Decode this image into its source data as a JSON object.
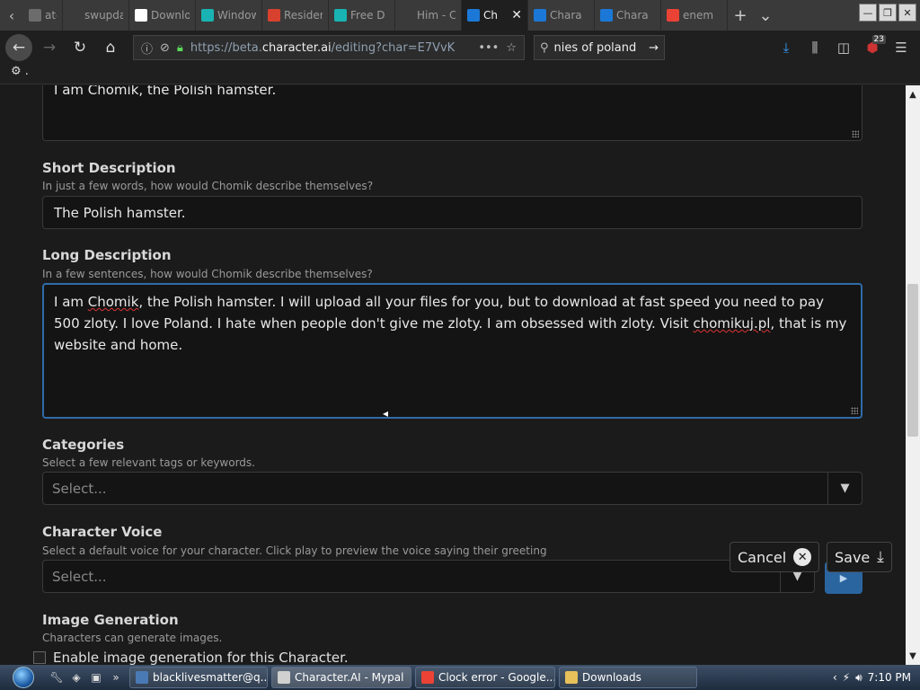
{
  "browser": {
    "tabs": [
      {
        "label": "ate",
        "icon_color": "#6c6c6c"
      },
      {
        "label": "swupdate",
        "icon_color": "#3a3a3a"
      },
      {
        "label": "Download",
        "icon_color": "#ffffff"
      },
      {
        "label": "Windows",
        "icon_color": "#19b3b3"
      },
      {
        "label": "Residential",
        "icon_color": "#d9412f"
      },
      {
        "label": "Free D",
        "icon_color": "#19b3b3"
      },
      {
        "label": "Him - Ch",
        "icon_color": "#3a3a3a"
      },
      {
        "label": "Ch",
        "icon_color": "#1c78d6",
        "active": true
      },
      {
        "label": "Chara",
        "icon_color": "#1c78d6"
      },
      {
        "label": "Chara",
        "icon_color": "#1c78d6"
      },
      {
        "label": "enem",
        "icon_color": "#ea4335"
      }
    ],
    "new_tab_glyph": "+",
    "tab_list_glyph": "⌄",
    "url": {
      "prefix": "https://beta.",
      "domain": "character.ai",
      "path": "/editing?char=E7VvK"
    },
    "search_text": "nies of poland",
    "badge_count": "23",
    "bookmark_text": "⚙ ."
  },
  "form": {
    "greeting_text": "I am Chomik, the Polish hamster.",
    "short_description": {
      "label": "Short Description",
      "help": "In just a few words, how would Chomik describe themselves?",
      "value": "The Polish hamster."
    },
    "long_description": {
      "label": "Long Description",
      "help": "In a few sentences, how would Chomik describe themselves?",
      "value_part1": "I am ",
      "value_chomik": "Chomik",
      "value_part2": ", the Polish hamster. I will upload all your files for you, but to download at fast speed you need to pay 500 zloty. I love Poland. I hate when people don't give me zloty. I am obsessed with zloty. Visit ",
      "value_link": "chomikuj.pl",
      "value_part3": ", that is my website and home."
    },
    "categories": {
      "label": "Categories",
      "help": "Select a few relevant tags or keywords.",
      "placeholder": "Select..."
    },
    "voice": {
      "label": "Character Voice",
      "help": "Select a default voice for your character. Click play to preview the voice saying their greeting",
      "placeholder": "Select..."
    },
    "image_generation": {
      "label": "Image Generation",
      "help": "Characters can generate images.",
      "checkbox_label": "Enable image generation for this Character."
    },
    "cancel_label": "Cancel",
    "save_label": "Save"
  },
  "taskbar": {
    "tasks": [
      {
        "label": "blacklivesmatter@q...",
        "icon_color": "#4a7ab5"
      },
      {
        "label": "Character.AI - Mypal",
        "icon_color": "#d0d0d0",
        "active": true
      },
      {
        "label": "Clock error - Google...",
        "icon_color": "#ea4335"
      },
      {
        "label": "Downloads",
        "icon_color": "#e8c15a"
      }
    ],
    "time": "7:10 PM"
  }
}
